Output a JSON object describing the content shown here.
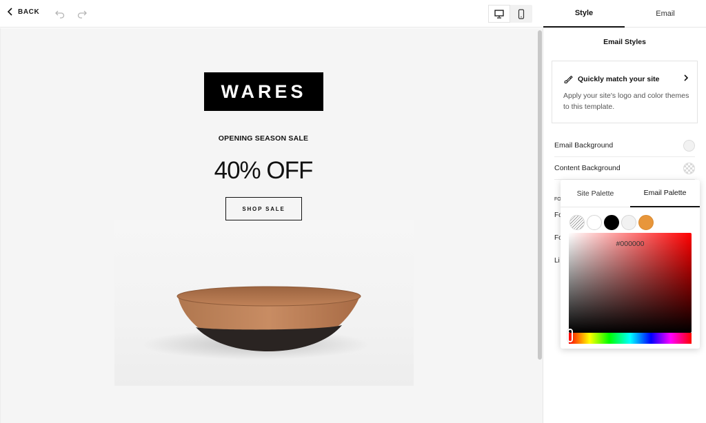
{
  "topbar": {
    "back_label": "BACK",
    "icons": [
      "chevron-left-icon",
      "undo-icon",
      "redo-icon",
      "desktop-icon",
      "mobile-icon"
    ],
    "active_device": "desktop"
  },
  "email": {
    "logo_text": "WARES",
    "kicker": "OPENING SEASON SALE",
    "headline": "40% OFF",
    "button_label": "SHOP SALE"
  },
  "panel": {
    "tabs": [
      {
        "label": "Style",
        "active": true
      },
      {
        "label": "Email",
        "active": false
      }
    ],
    "title": "Email Styles",
    "match_card": {
      "title": "Quickly match your site",
      "description": "Apply your site's logo and color themes to this template."
    },
    "rows": [
      {
        "label": "Email Background"
      },
      {
        "label": "Content Background"
      }
    ],
    "partial_rows": [
      "FO",
      "Fo",
      "Fo",
      "Li"
    ]
  },
  "color_popover": {
    "tabs": [
      {
        "label": "Site Palette",
        "active": false
      },
      {
        "label": "Email Palette",
        "active": true
      }
    ],
    "swatches": [
      {
        "name": "transparent",
        "color": "transparent"
      },
      {
        "name": "white",
        "color": "#ffffff"
      },
      {
        "name": "black",
        "color": "#000000"
      },
      {
        "name": "light-gray",
        "color": "#f2f2f2"
      },
      {
        "name": "orange",
        "color": "#e8963a"
      }
    ],
    "hex_value": "#000000",
    "colors": {
      "email_background": "#f5f5f5",
      "hue": "#ff0000"
    }
  }
}
